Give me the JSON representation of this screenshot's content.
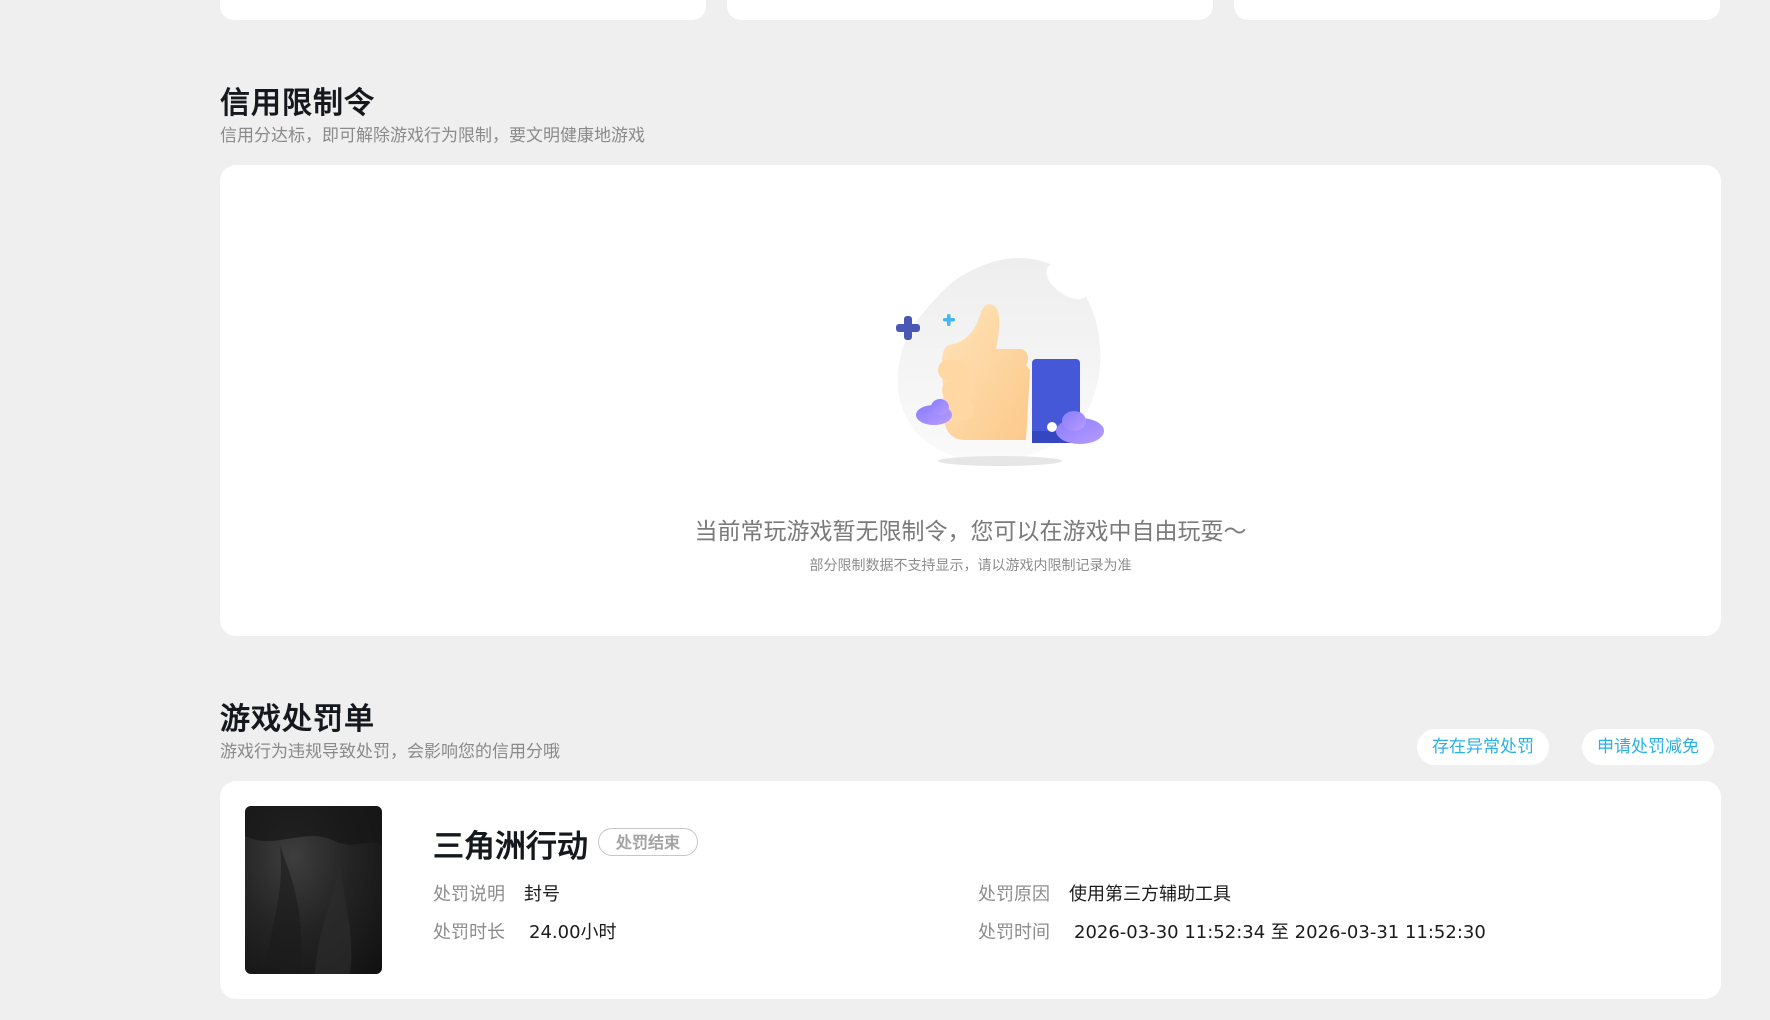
{
  "restriction_section": {
    "title": "信用限制令",
    "subtitle": "信用分达标，即可解除游戏行为限制，要文明健康地游戏",
    "empty_title": "当前常玩游戏暂无限制令，您可以在游戏中自由玩耍～",
    "empty_note": "部分限制数据不支持显示，请以游戏内限制记录为准",
    "illustration_icon": "thumbs-up-illustration"
  },
  "penalty_section": {
    "title": "游戏处罚单",
    "subtitle": "游戏行为违规导致处罚，会影响您的信用分哦",
    "abnormal_button": "存在异常处罚",
    "appeal_button": "申请处罚减免",
    "accent_color": "#2bb0e6",
    "record": {
      "game_name": "三角洲行动",
      "status": "处罚结束",
      "desc_label": "处罚说明",
      "desc_value": "封号",
      "duration_label": "处罚时长",
      "duration_value": "24.00小时",
      "reason_label": "处罚原因",
      "reason_value": "使用第三方辅助工具",
      "time_label": "处罚时间",
      "time_value": "2026-03-30 11:52:34 至 2026-03-31 11:52:30"
    }
  }
}
